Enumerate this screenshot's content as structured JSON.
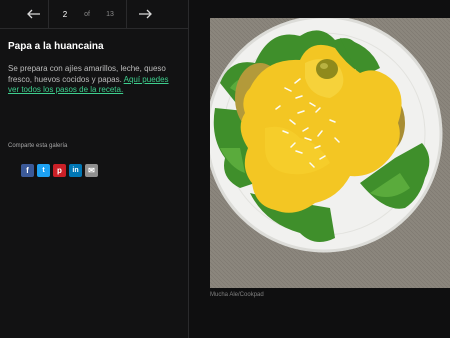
{
  "pager": {
    "current": "2",
    "of": "of",
    "total": "13",
    "prev_icon": "arrow-left-icon",
    "next_icon": "arrow-right-icon"
  },
  "article": {
    "title": "Papa a la huancaina",
    "description": "Se prepara con ajíes amarillos, leche, queso fresco, huevos cocidos y papas. ",
    "link_text": "Aquí puedes ver todos los pasos de la receta."
  },
  "share": {
    "label": "Comparte esta galería",
    "buttons": [
      {
        "name": "facebook",
        "glyph": "f",
        "color": "#3b5998"
      },
      {
        "name": "twitter",
        "glyph": "t",
        "color": "#1da1f2"
      },
      {
        "name": "pinterest",
        "glyph": "p",
        "color": "#cb2027"
      },
      {
        "name": "linkedin",
        "glyph": "in",
        "color": "#0077b5"
      },
      {
        "name": "email",
        "glyph": "✉",
        "color": "#8f8f8f"
      }
    ]
  },
  "image": {
    "credit": "Mucha Ale/Cookpad"
  },
  "colors": {
    "background": "#0f0f10",
    "link": "#3ecf8e",
    "sauce": "#f3c623",
    "lettuce": "#3f8f2b"
  }
}
